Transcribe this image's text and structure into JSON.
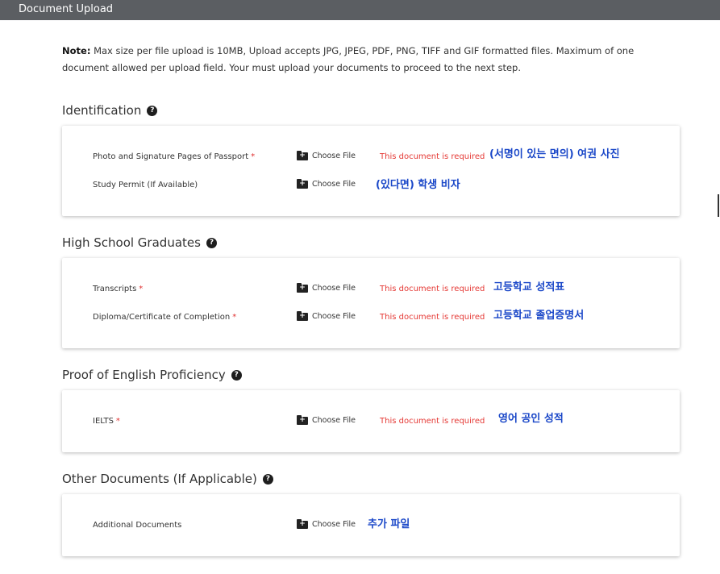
{
  "header": {
    "title": "Document Upload"
  },
  "note": {
    "label": "Note:",
    "text": " Max size per file upload is 10MB, Upload accepts JPG, JPEG, PDF, PNG, TIFF and GIF formatted files. Maximum of one document allowed per upload field. Your must upload your documents to proceed to the next step."
  },
  "choose_label": "Choose File",
  "required_msg": "This document is required",
  "required_mark": "*",
  "help_glyph": "?",
  "sections": [
    {
      "title": "Identification",
      "rows": [
        {
          "label": "Photo and Signature Pages of Passport",
          "annotation": "(서명이 있는 면의) 여권 사진"
        },
        {
          "label": "Study Permit (If Available)",
          "annotation": "(있다면) 학생 비자"
        }
      ]
    },
    {
      "title": "High School Graduates",
      "rows": [
        {
          "label": "Transcripts",
          "annotation": "고등학교 성적표"
        },
        {
          "label": "Diploma/Certificate of Completion",
          "annotation": "고등학교 졸업증명서"
        }
      ]
    },
    {
      "title": "Proof of English Proficiency",
      "rows": [
        {
          "label": "IELTS",
          "annotation": "영어 공인 성적"
        }
      ]
    },
    {
      "title": "Other Documents (If Applicable)",
      "rows": [
        {
          "label": "Additional Documents",
          "annotation": "추가 파일"
        }
      ]
    }
  ]
}
